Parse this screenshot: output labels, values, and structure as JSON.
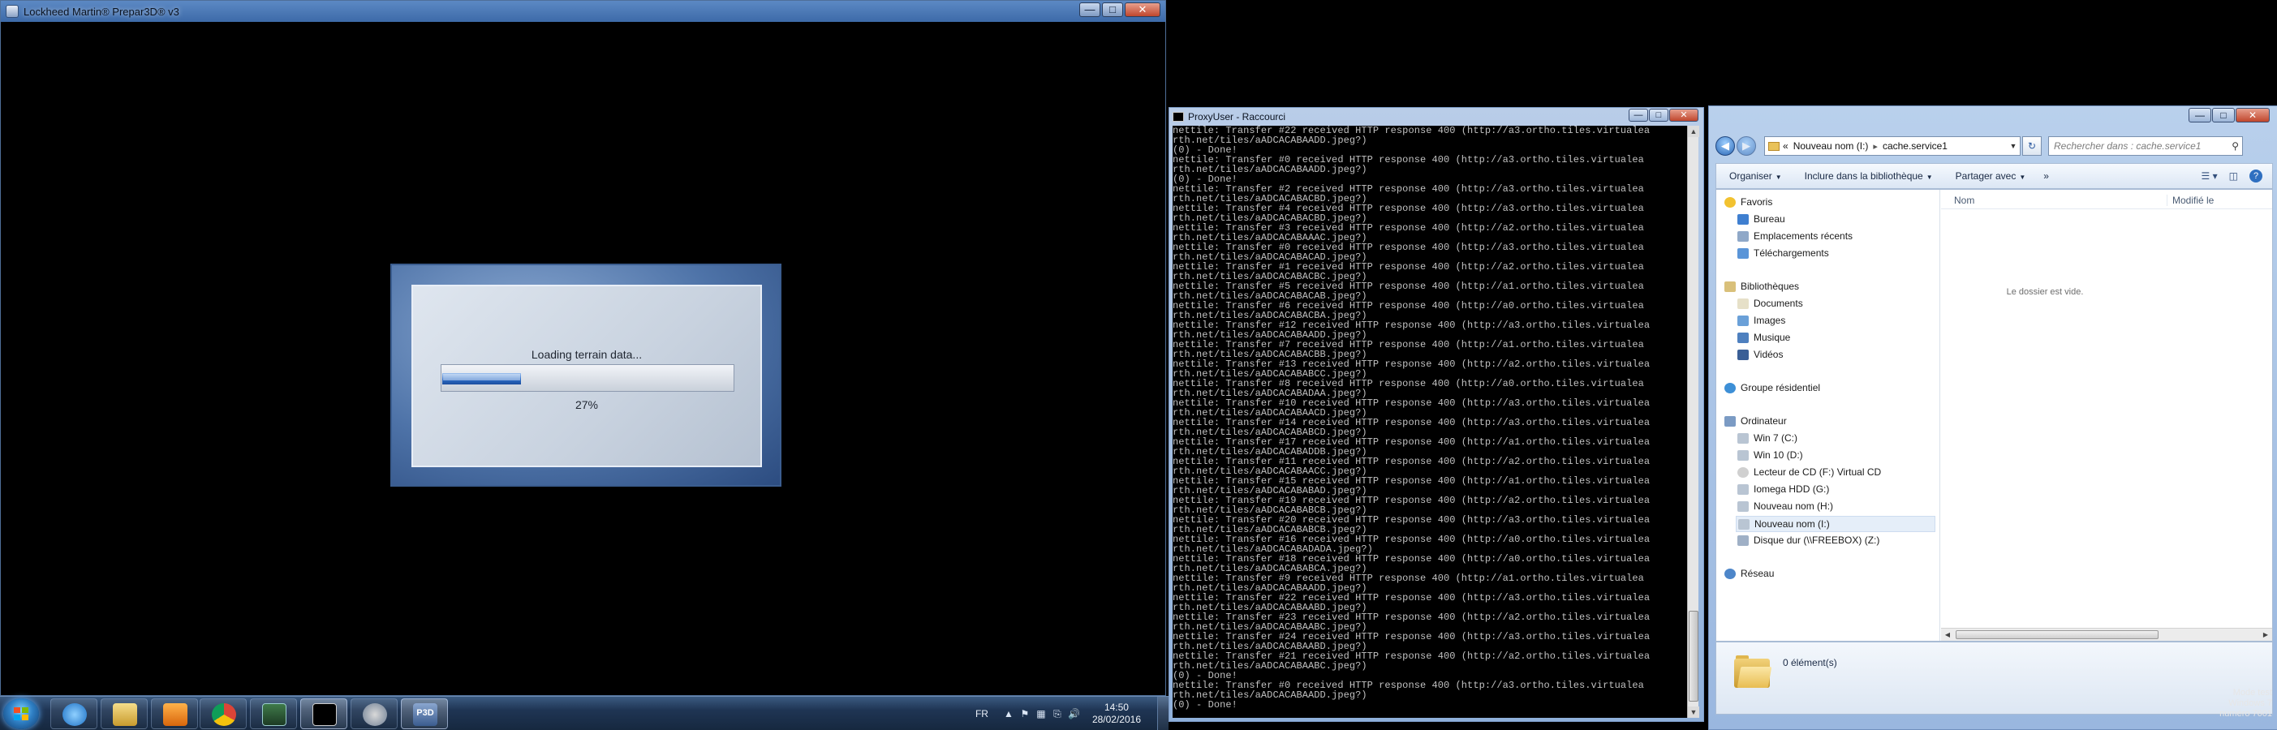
{
  "prepar3d": {
    "title": "Lockheed Martin® Prepar3D® v3",
    "loading_text": "Loading terrain data...",
    "progress_percent": 27,
    "progress_label": "27%"
  },
  "taskbar": {
    "language": "FR",
    "time": "14:50",
    "date": "28/02/2016",
    "p3d_label": "P3D",
    "start_flag_colors": [
      "#f25022",
      "#7fba00",
      "#00a4ef",
      "#ffb900"
    ]
  },
  "console": {
    "title": "ProxyUser - Raccourci",
    "lines": [
      "nettile: Transfer #22 received HTTP response 400 (http://a3.ortho.tiles.virtualea",
      "rth.net/tiles/aADCACABAADD.jpeg?)",
      "(0) - Done!",
      "nettile: Transfer #0 received HTTP response 400 (http://a3.ortho.tiles.virtualea",
      "rth.net/tiles/aADCACABAADD.jpeg?)",
      "(0) - Done!",
      "nettile: Transfer #2 received HTTP response 400 (http://a3.ortho.tiles.virtualea",
      "rth.net/tiles/aADCACABACBD.jpeg?)",
      "nettile: Transfer #4 received HTTP response 400 (http://a3.ortho.tiles.virtualea",
      "rth.net/tiles/aADCACABACBD.jpeg?)",
      "nettile: Transfer #3 received HTTP response 400 (http://a2.ortho.tiles.virtualea",
      "rth.net/tiles/aADCACABAAAC.jpeg?)",
      "nettile: Transfer #0 received HTTP response 400 (http://a3.ortho.tiles.virtualea",
      "rth.net/tiles/aADCACABACAD.jpeg?)",
      "nettile: Transfer #1 received HTTP response 400 (http://a2.ortho.tiles.virtualea",
      "rth.net/tiles/aADCACABACBC.jpeg?)",
      "nettile: Transfer #5 received HTTP response 400 (http://a1.ortho.tiles.virtualea",
      "rth.net/tiles/aADCACABACAB.jpeg?)",
      "nettile: Transfer #6 received HTTP response 400 (http://a0.ortho.tiles.virtualea",
      "rth.net/tiles/aADCACABACBA.jpeg?)",
      "nettile: Transfer #12 received HTTP response 400 (http://a3.ortho.tiles.virtualea",
      "rth.net/tiles/aADCACABAADD.jpeg?)",
      "nettile: Transfer #7 received HTTP response 400 (http://a1.ortho.tiles.virtualea",
      "rth.net/tiles/aADCACABACBB.jpeg?)",
      "nettile: Transfer #13 received HTTP response 400 (http://a2.ortho.tiles.virtualea",
      "rth.net/tiles/aADCACABABCC.jpeg?)",
      "nettile: Transfer #8 received HTTP response 400 (http://a0.ortho.tiles.virtualea",
      "rth.net/tiles/aADCACABADAA.jpeg?)",
      "nettile: Transfer #10 received HTTP response 400 (http://a3.ortho.tiles.virtualea",
      "rth.net/tiles/aADCACABAACD.jpeg?)",
      "nettile: Transfer #14 received HTTP response 400 (http://a3.ortho.tiles.virtualea",
      "rth.net/tiles/aADCACABABCD.jpeg?)",
      "nettile: Transfer #17 received HTTP response 400 (http://a1.ortho.tiles.virtualea",
      "rth.net/tiles/aADCACABADDB.jpeg?)",
      "nettile: Transfer #11 received HTTP response 400 (http://a2.ortho.tiles.virtualea",
      "rth.net/tiles/aADCACABAACC.jpeg?)",
      "nettile: Transfer #15 received HTTP response 400 (http://a1.ortho.tiles.virtualea",
      "rth.net/tiles/aADCACABABAD.jpeg?)",
      "nettile: Transfer #19 received HTTP response 400 (http://a2.ortho.tiles.virtualea",
      "rth.net/tiles/aADCACABABCB.jpeg?)",
      "nettile: Transfer #20 received HTTP response 400 (http://a3.ortho.tiles.virtualea",
      "rth.net/tiles/aADCACABABCB.jpeg?)",
      "nettile: Transfer #16 received HTTP response 400 (http://a0.ortho.tiles.virtualea",
      "rth.net/tiles/aADCACABADADA.jpeg?)",
      "nettile: Transfer #18 received HTTP response 400 (http://a0.ortho.tiles.virtualea",
      "rth.net/tiles/aADCACABABCA.jpeg?)",
      "nettile: Transfer #9 received HTTP response 400 (http://a1.ortho.tiles.virtualea",
      "rth.net/tiles/aADCACABAADD.jpeg?)",
      "nettile: Transfer #22 received HTTP response 400 (http://a3.ortho.tiles.virtualea",
      "rth.net/tiles/aADCACABAABD.jpeg?)",
      "nettile: Transfer #23 received HTTP response 400 (http://a2.ortho.tiles.virtualea",
      "rth.net/tiles/aADCACABAABC.jpeg?)",
      "nettile: Transfer #24 received HTTP response 400 (http://a3.ortho.tiles.virtualea",
      "rth.net/tiles/aADCACABAABD.jpeg?)",
      "nettile: Transfer #21 received HTTP response 400 (http://a2.ortho.tiles.virtualea",
      "rth.net/tiles/aADCACABAABC.jpeg?)",
      "(0) - Done!",
      "nettile: Transfer #0 received HTTP response 400 (http://a3.ortho.tiles.virtualea",
      "rth.net/tiles/aADCACABAADD.jpeg?)",
      "(0) - Done!"
    ]
  },
  "explorer": {
    "address": {
      "prefix": "«",
      "part1": "Nouveau nom (I:)",
      "part2": "cache.service1"
    },
    "search_placeholder": "Rechercher dans : cache.service1",
    "commands": {
      "organize": "Organiser",
      "include": "Inclure dans la bibliothèque",
      "share": "Partager avec",
      "more": "»"
    },
    "nav": {
      "favorites": "Favoris",
      "desktop": "Bureau",
      "recent": "Emplacements récents",
      "downloads": "Téléchargements",
      "libraries": "Bibliothèques",
      "documents": "Documents",
      "images": "Images",
      "music": "Musique",
      "videos": "Vidéos",
      "homegroup": "Groupe résidentiel",
      "computer": "Ordinateur",
      "drive_c": "Win 7 (C:)",
      "drive_d": "Win 10 (D:)",
      "drive_f": "Lecteur de CD (F:) Virtual CD",
      "drive_g": "Iomega HDD (G:)",
      "drive_h": "Nouveau nom (H:)",
      "drive_i": "Nouveau nom (I:)",
      "drive_z": "Disque dur (\\\\FREEBOX) (Z:)",
      "network": "Réseau"
    },
    "columns": {
      "name": "Nom",
      "modified": "Modifié le"
    },
    "empty_message": "Le dossier est vide.",
    "item_count": "0 élément(s)"
  },
  "watermark": {
    "line1": "Mode test",
    "line2": "Windows 7",
    "line3": "numéro 7601"
  }
}
